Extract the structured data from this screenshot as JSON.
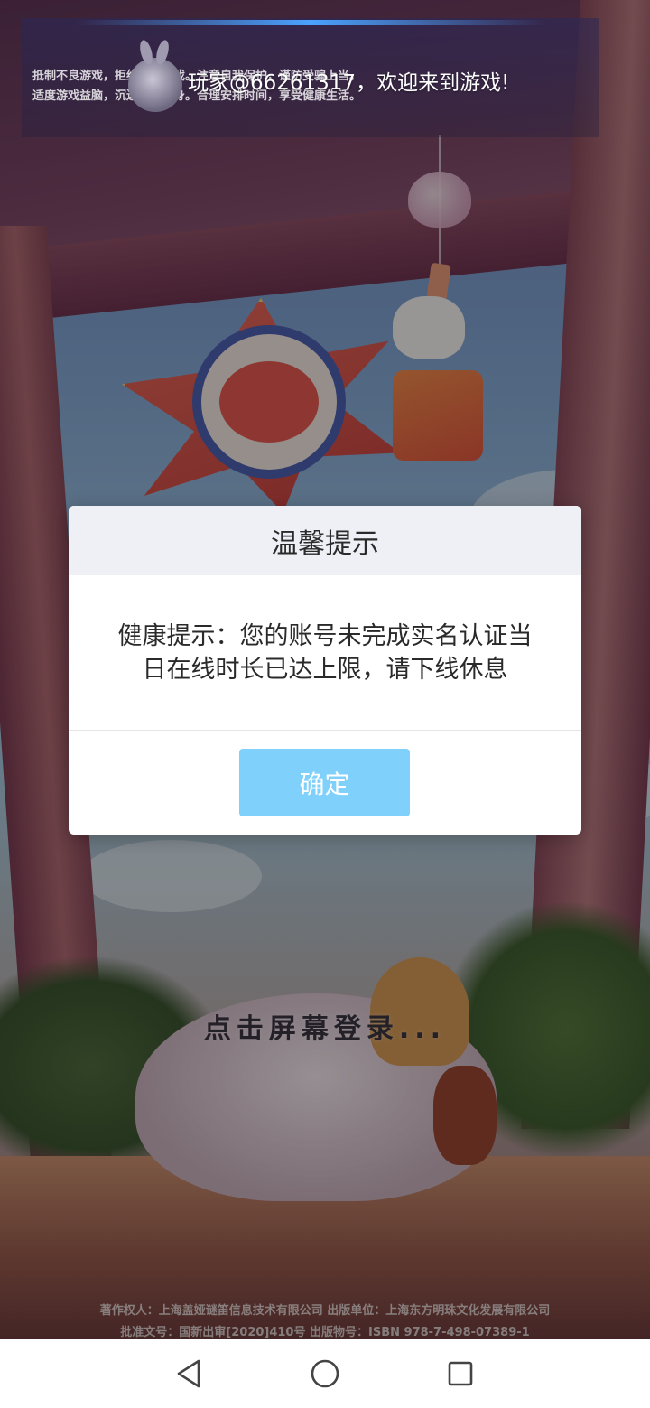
{
  "notice": {
    "advice_line1": "抵制不良游戏，拒绝盗版游戏。注意自我保护，谨防受骗上当。",
    "advice_line2": "适度游戏益脑，沉迷游戏伤身。合理安排时间，享受健康生活。",
    "welcome": "玩家@66261317，欢迎来到游戏!"
  },
  "dialog": {
    "title": "温馨提示",
    "message_line1": "健康提示：您的账号未完成实名认证当",
    "message_line2": "日在线时长已达上限，请下线休息",
    "confirm_label": "确定"
  },
  "scene": {
    "tap_to_login": "点击屏幕登录..."
  },
  "credits": {
    "line1": "著作权人：上海盖娅谜笛信息技术有限公司 出版单位：上海东方明珠文化发展有限公司",
    "line2": "批准文号：国新出审[2020]410号  出版物号：ISBN 978-7-498-07389-1"
  },
  "navbar": {
    "back_icon": "back-triangle-icon",
    "home_icon": "home-circle-icon",
    "recents_icon": "recents-square-icon"
  },
  "colors": {
    "confirm_button": "#7fd0fb",
    "dialog_header": "#eef0f6",
    "dialog_text": "#2a2a2a"
  }
}
